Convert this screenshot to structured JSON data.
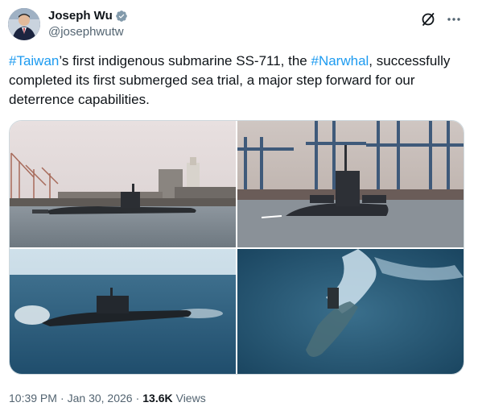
{
  "author": {
    "display_name": "Joseph Wu",
    "handle": "@josephwutw",
    "avatar_icon": "profile-photo",
    "verified_icon": "verified-badge-icon",
    "verified_color": "#829aab"
  },
  "header_actions": {
    "grok_icon": "grok-icon",
    "more_icon": "more-icon"
  },
  "tweet": {
    "hashtag_1": "#Taiwan",
    "text_1": "’s first indigenous submarine SS-711, the ",
    "hashtag_2": "#Narwhal",
    "text_2": ", successfully completed its first submerged sea trial, a major step forward for our deterrence capabilities."
  },
  "media": [
    {
      "alt": "submarine-in-harbor"
    },
    {
      "alt": "submarine-with-crew-near-port-cranes"
    },
    {
      "alt": "submarine-at-sea-surfacing"
    },
    {
      "alt": "submarine-submerging-aerial-view"
    }
  ],
  "meta": {
    "time": "10:39 PM",
    "separator": "·",
    "date": "Jan 30, 2026",
    "separator_2": "·",
    "views_count": "13.6K",
    "views_label": "Views"
  },
  "colors": {
    "link": "#1d9bf0",
    "text": "#0f1419",
    "secondary": "#536471",
    "border": "#cfd9de"
  }
}
